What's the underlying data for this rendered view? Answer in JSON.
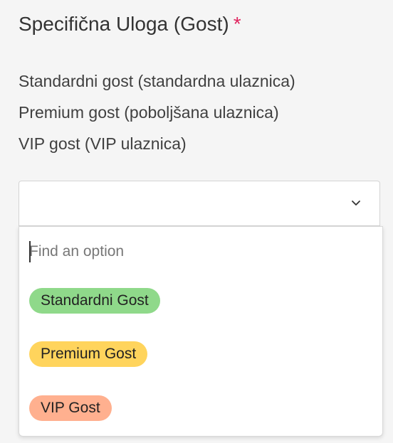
{
  "field": {
    "label": "Specifična Uloga (Gost)",
    "required_mark": "*",
    "help_lines": [
      "Standardni gost (standardna ulaznica)",
      "Premium gost (poboljšana ulaznica)",
      "VIP gost (VIP ulaznica)"
    ]
  },
  "select": {
    "value": "",
    "icon": "chevron-down-icon"
  },
  "dropdown": {
    "search_placeholder": "Find an option",
    "options": [
      {
        "label": "Standardni Gost",
        "color": "#8fd98a"
      },
      {
        "label": "Premium Gost",
        "color": "#ffd45c"
      },
      {
        "label": "VIP Gost",
        "color": "#ffb08f"
      }
    ]
  },
  "colors": {
    "required": "#e0245e",
    "background": "#f5f5f5"
  }
}
